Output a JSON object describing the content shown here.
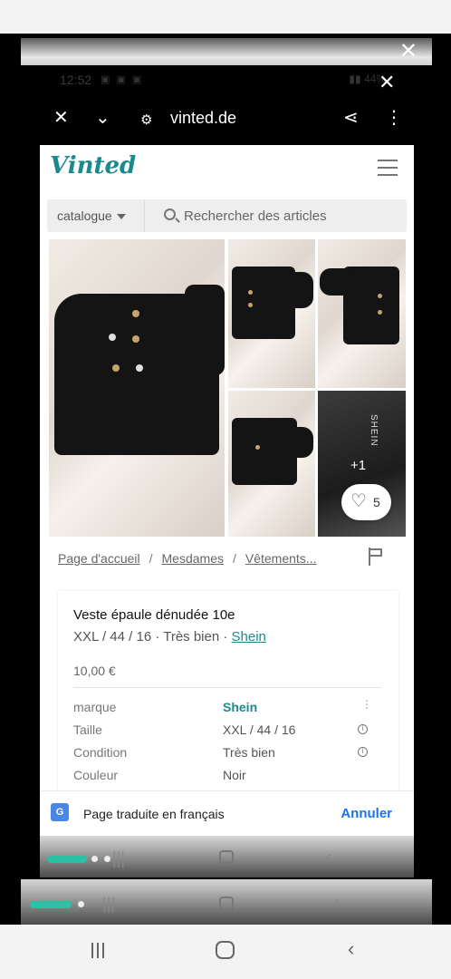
{
  "status_bar": {
    "time": "12:52",
    "battery": "44%"
  },
  "browser": {
    "url": "vinted.de"
  },
  "site": {
    "logo": "Vinted",
    "search": {
      "category_label": "catalogue",
      "placeholder": "Rechercher des articles"
    }
  },
  "photos": {
    "extra_count": "+1",
    "favorites_count": "5",
    "tag_text": "SHEIN"
  },
  "breadcrumb": [
    "Page d'accueil",
    "Mesdames",
    "Vêtements..."
  ],
  "item": {
    "title": "Veste épaule dénudée 10e",
    "size_line": "XXL / 44 / 16 · Très bien · ",
    "brand_link": "Shein",
    "price": "10,00 €",
    "details": [
      {
        "label": "marque",
        "value": "Shein"
      },
      {
        "label": "Taille",
        "value": "XXL / 44 / 16"
      },
      {
        "label": "Condition",
        "value": "Très bien"
      },
      {
        "label": "Couleur",
        "value": "Noir"
      }
    ]
  },
  "translate_bar": {
    "message": "Page traduite en français",
    "cancel_label": "Annuler"
  },
  "colors": {
    "brand_teal": "#1b8a8f",
    "link_blue": "#1a73e8",
    "nav_pill": "#29c2a5"
  }
}
